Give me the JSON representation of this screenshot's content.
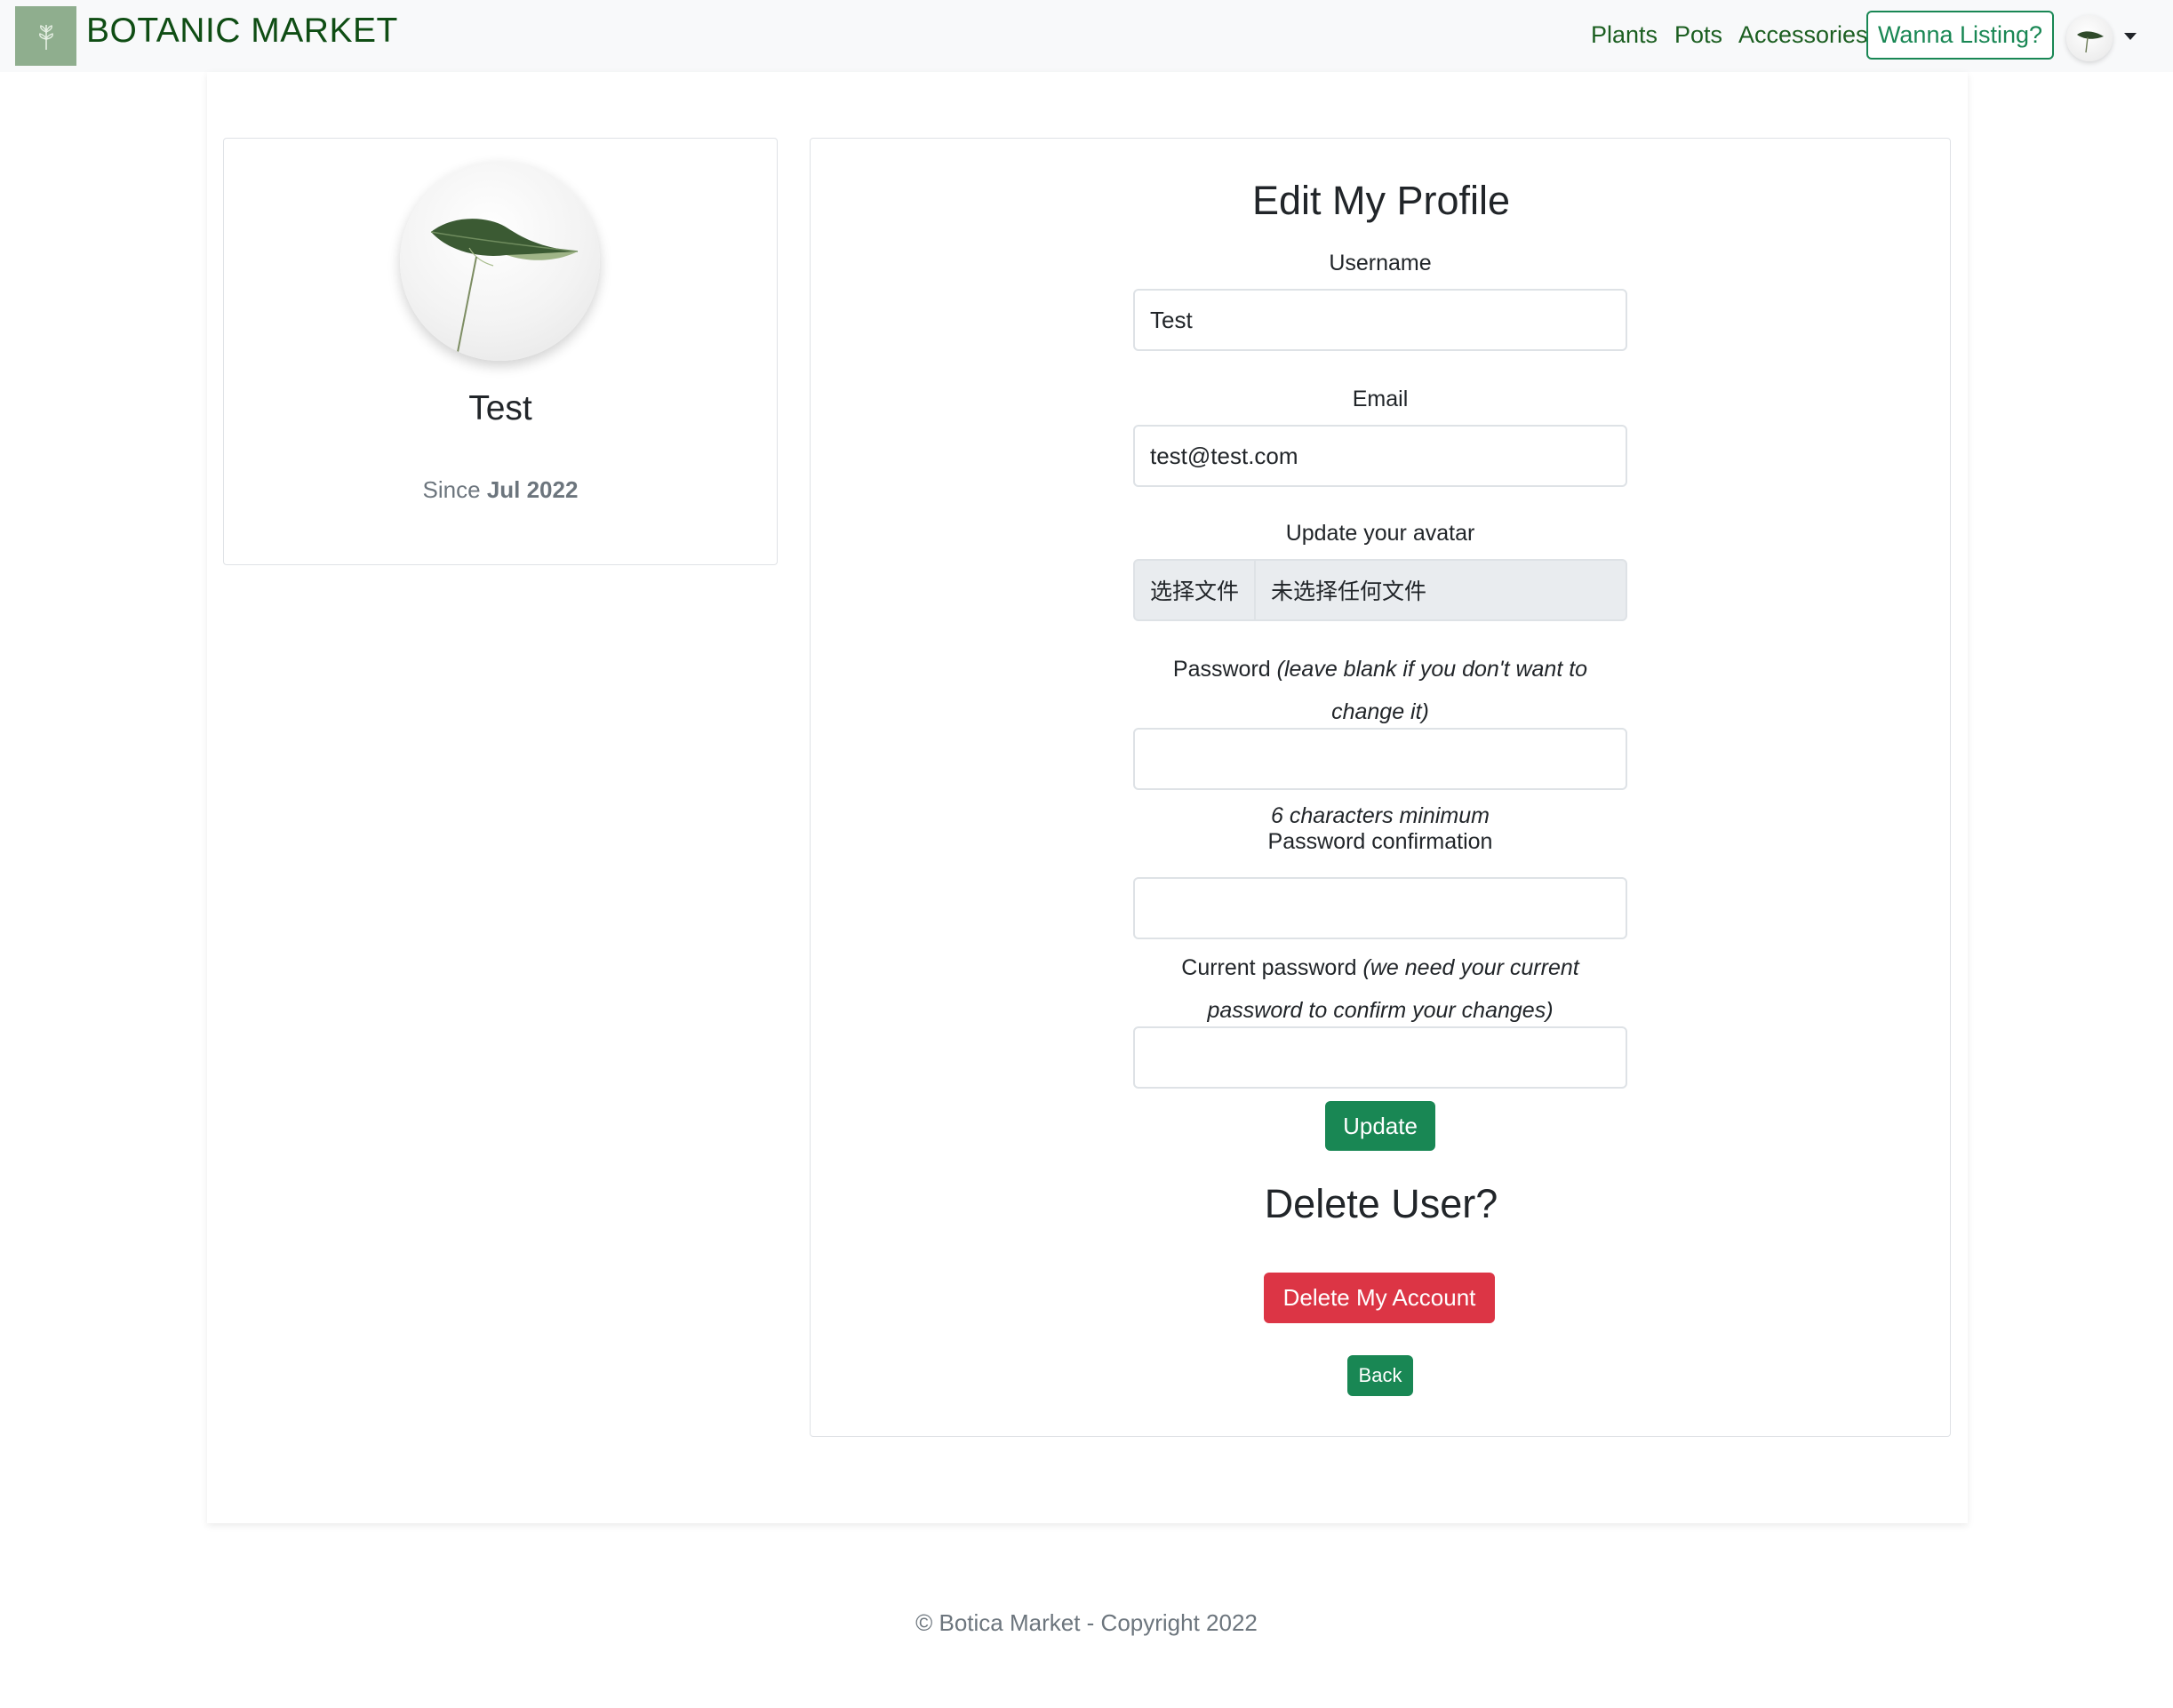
{
  "navbar": {
    "brand": "BOTANIC MARKET",
    "links": [
      "Plants",
      "Pots",
      "Accessories"
    ],
    "listing_button": "Wanna Listing?"
  },
  "profile": {
    "name": "Test",
    "since_prefix": "Since",
    "since_date": "Jul 2022"
  },
  "form": {
    "title": "Edit My Profile",
    "username_label": "Username",
    "username_value": "Test",
    "email_label": "Email",
    "email_value": "test@test.com",
    "avatar_label": "Update your avatar",
    "file_button": "选择文件",
    "file_status": "未选择任何文件",
    "password_label": "Password",
    "password_note_line1": "(leave blank if you don't want to",
    "password_note_line2": "change it)",
    "password_hint": "6 characters minimum",
    "password_confirm_label": "Password confirmation",
    "current_password_label": "Current password",
    "current_password_note_line1": "(we need your current",
    "current_password_note_line2": "password to confirm your changes)",
    "update_button": "Update",
    "delete_title": "Delete User?",
    "delete_button": "Delete My Account",
    "back_button": "Back"
  },
  "footer": {
    "text": "© Botica Market - Copyright 2022"
  }
}
